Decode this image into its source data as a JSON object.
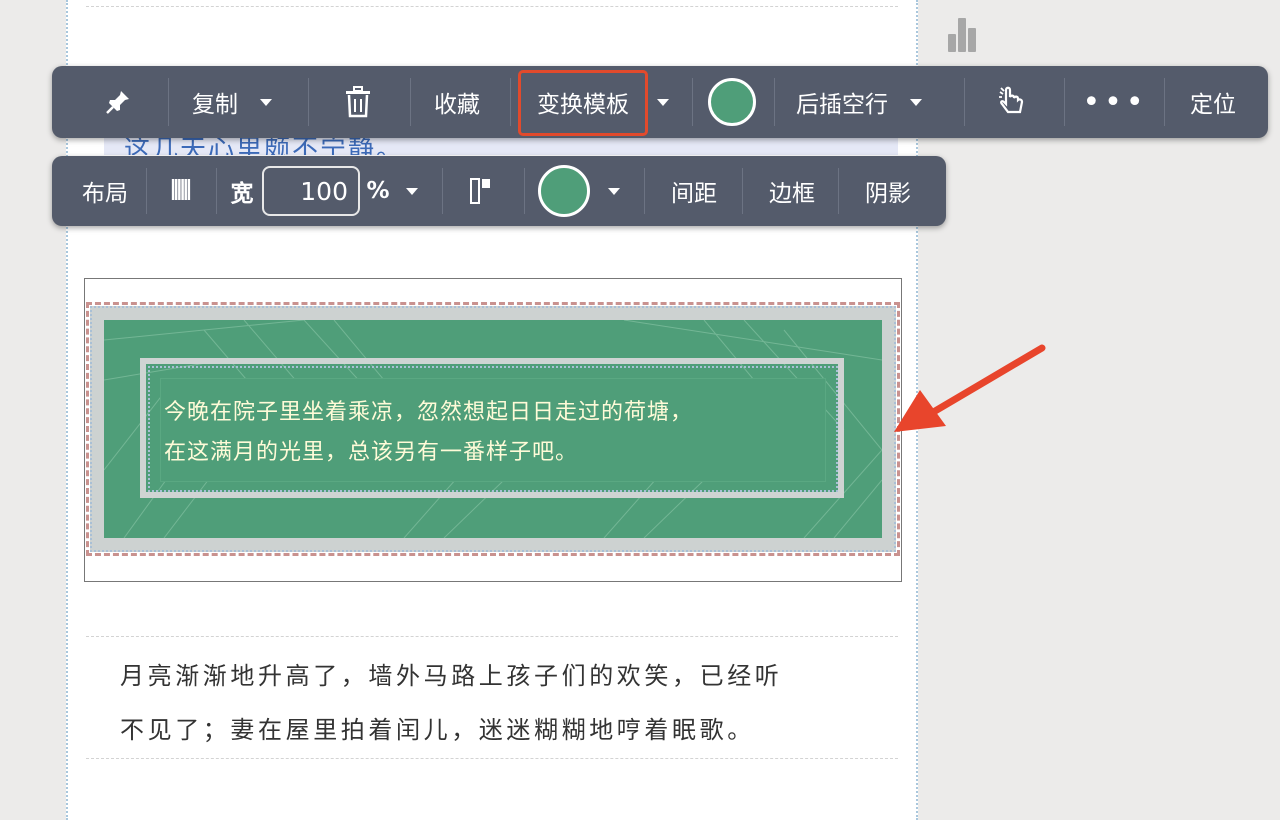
{
  "toolbar_top": {
    "pin_icon": "pin-icon",
    "copy_label": "复制",
    "delete_icon": "trash-icon",
    "favorite_label": "收藏",
    "change_template_label": "变换模板",
    "color": "#4f9e79",
    "insert_blank_label": "后插空行",
    "pointer_icon": "hand-pointer-icon",
    "more_icon": "more-dots-icon",
    "locate_label": "定位"
  },
  "toolbar_bottom": {
    "layout_label": "布局",
    "columns_icon": "columns-icon",
    "width_label": "宽",
    "width_value": "100",
    "width_unit": "%",
    "align_icon": "align-top-icon",
    "color": "#4f9e79",
    "spacing_label": "间距",
    "border_label": "边框",
    "shadow_label": "阴影"
  },
  "peek_text": "这几天心里颇不宁静。",
  "card": {
    "line1": "今晚在院子里坐着乘凉，忽然想起日日走过的荷塘，",
    "line2": "在这满月的光里，总该另有一番样子吧。"
  },
  "paragraph": {
    "line1": "月亮渐渐地升高了，墙外马路上孩子们的欢笑，已经听",
    "line2": "不见了；妻在屋里拍着闰儿，迷迷糊糊地哼着眠歌。"
  },
  "colors": {
    "accent": "#4f9e79",
    "highlight": "#e24a2c",
    "toolbar_bg": "#545b6b",
    "arrow": "#e8452c"
  }
}
